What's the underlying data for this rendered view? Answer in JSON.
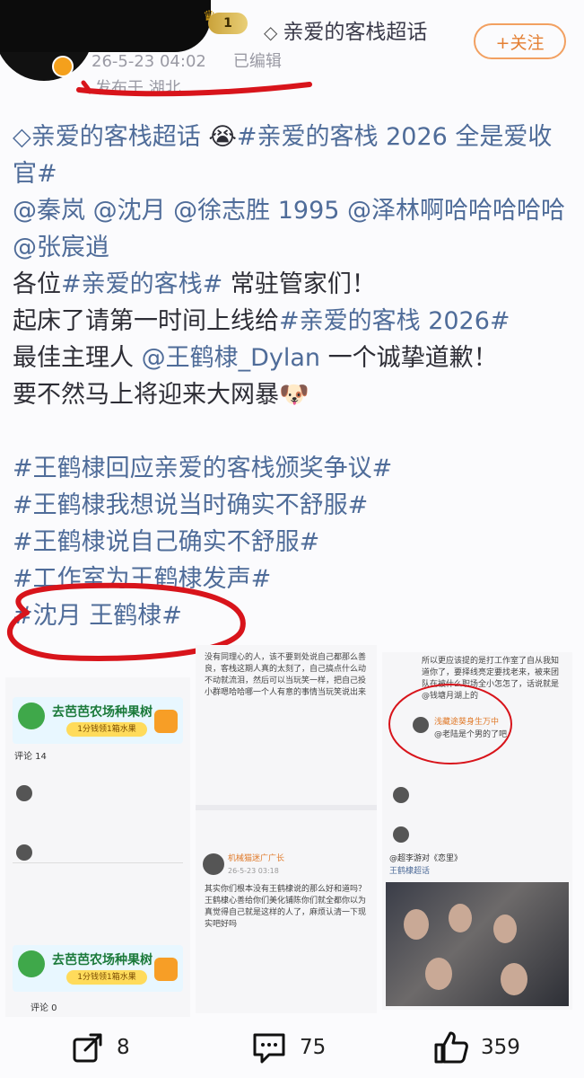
{
  "header": {
    "level_badge": "1",
    "topic": "亲爱的客栈超话",
    "follow_label": "+关注",
    "date": "26-5-23 04:02",
    "edited": "已编辑",
    "location": "发布于 湖北"
  },
  "post": {
    "line1_topic": "亲爱的客栈超话",
    "line1_tag": "#亲爱的客栈 2026 全是爱收官#",
    "mentions": "@秦岚 @沈月 @徐志胜 1995 @泽林啊哈哈哈哈哈 @张宸逍",
    "l3_pre": "各位",
    "l3_tag": "#亲爱的客栈#",
    "l3_post": " 常驻管家们！",
    "l4_pre": "起床了请第一时间上线给",
    "l4_tag": "#亲爱的客栈 2026#",
    "l5_pre": "最佳主理人 ",
    "l5_at": "@王鹤棣_Dylan",
    "l5_post": " 一个诚挚道歉！",
    "l6": "要不然马上将迎来大网暴",
    "tags": [
      "#王鹤棣回应亲爱的客栈颁奖争议#",
      "#王鹤棣我想说当时确实不舒服#",
      "#王鹤棣说自己确实不舒服#",
      "#工作室为王鹤棣发声#",
      "#沈月 王鹤棣#"
    ]
  },
  "collage": {
    "farm_title": "去芭芭农场种果树",
    "farm_button": "1分钱领1箱水果",
    "comments_label": "评论 14",
    "comments_label2": "评论 0",
    "p2_text": "没有同理心的人，该不要到处说自己都那么善良，客栈这期人真的太刻了，自己搞点什么动不动就流泪，然后可以当玩笑一样，把自己投小群嗯哈哈哪一个人有意的事情当玩笑说出来",
    "p2_user": "机械猫迷广广长",
    "p2_date": "26-5-23 03:18",
    "p2_body": "其实你们根本没有王鹤棣说的那么好和道吗？王鹤棣心善给你们美化铺陈你们就全都你以为真觉得自己就是这样的人了，麻烦认清一下现实吧好吗",
    "p3_text": "所以更应该提的是打工作室了自从我知道你了，要择线亮定要找老来，被来团队在被什么职场全小怎怎了，话说就是 @钱塘月湖上的",
    "p3_reply": "浅藏途葵身生万中",
    "p3_reply_text": "@老陆是个男的了吧",
    "p3_card_title": "@超李游对《恋里》",
    "p3_card_sub": "王鹤棣超话"
  },
  "actions": {
    "share": "8",
    "comment": "75",
    "like": "359"
  },
  "colors": {
    "tag": "#4f6c99",
    "follow": "#e47f32",
    "annotation": "#d8141b"
  }
}
